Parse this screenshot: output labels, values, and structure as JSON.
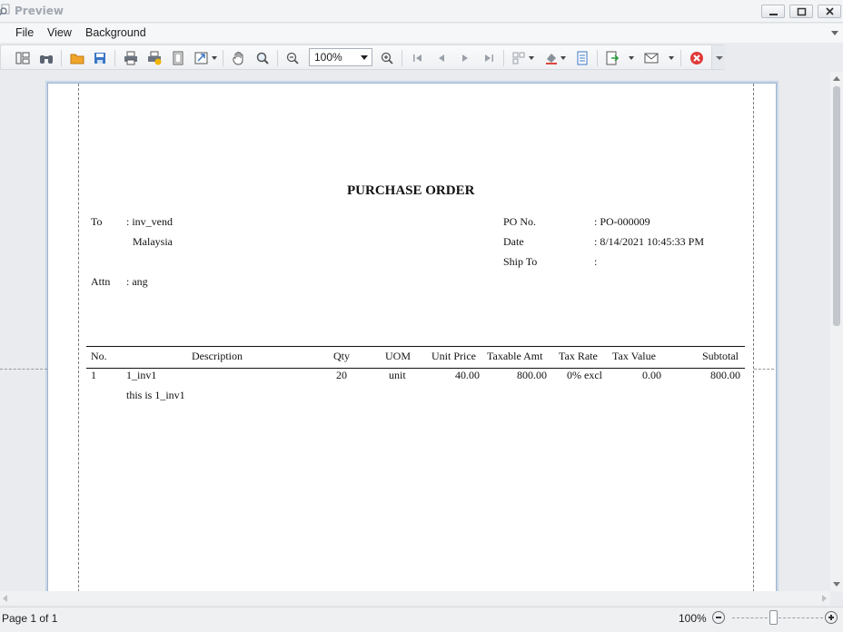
{
  "window": {
    "title": "Preview",
    "icon": "magnifier-page-icon"
  },
  "menu": {
    "items": [
      "File",
      "View",
      "Background"
    ]
  },
  "toolbar": {
    "zoom_value": "100%",
    "icons": [
      "document-map-icon",
      "binoculars-icon",
      "open-folder-icon",
      "save-icon",
      "print-icon",
      "quick-print-icon",
      "page-setup-icon",
      "scale-icon",
      "hand-tool-icon",
      "magnifier-icon",
      "zoom-out-icon",
      "zoom-in-icon",
      "first-page-icon",
      "previous-page-icon",
      "next-page-icon",
      "last-page-icon",
      "multiple-pages-icon",
      "background-color-icon",
      "watermark-icon",
      "export-icon",
      "send-email-icon",
      "close-preview-icon"
    ]
  },
  "document": {
    "title": "PURCHASE ORDER",
    "to_label": "To",
    "to_value": ": inv_vend",
    "to_country": "Malaysia",
    "attn_label": "Attn",
    "attn_value": ": ang",
    "po_label": "PO No.",
    "po_value": ": PO-000009",
    "date_label": "Date",
    "date_value": ": 8/14/2021 10:45:33 PM",
    "shipto_label": "Ship To",
    "shipto_value": ":",
    "columns": [
      "No.",
      "Description",
      "Qty",
      "UOM",
      "Unit Price",
      "Taxable Amt",
      "Tax Rate",
      "Tax Value",
      "Subtotal"
    ],
    "rows": [
      {
        "no": "1",
        "description": "1_inv1",
        "detail": "this is 1_inv1",
        "qty": "20",
        "uom": "unit",
        "unit_price": "40.00",
        "taxable_amt": "800.00",
        "tax_rate": "0% excl",
        "tax_value": "0.00",
        "subtotal": "800.00"
      }
    ]
  },
  "status": {
    "page": "Page 1 of 1",
    "zoom": "100%",
    "zoom_level_percent": 100
  }
}
